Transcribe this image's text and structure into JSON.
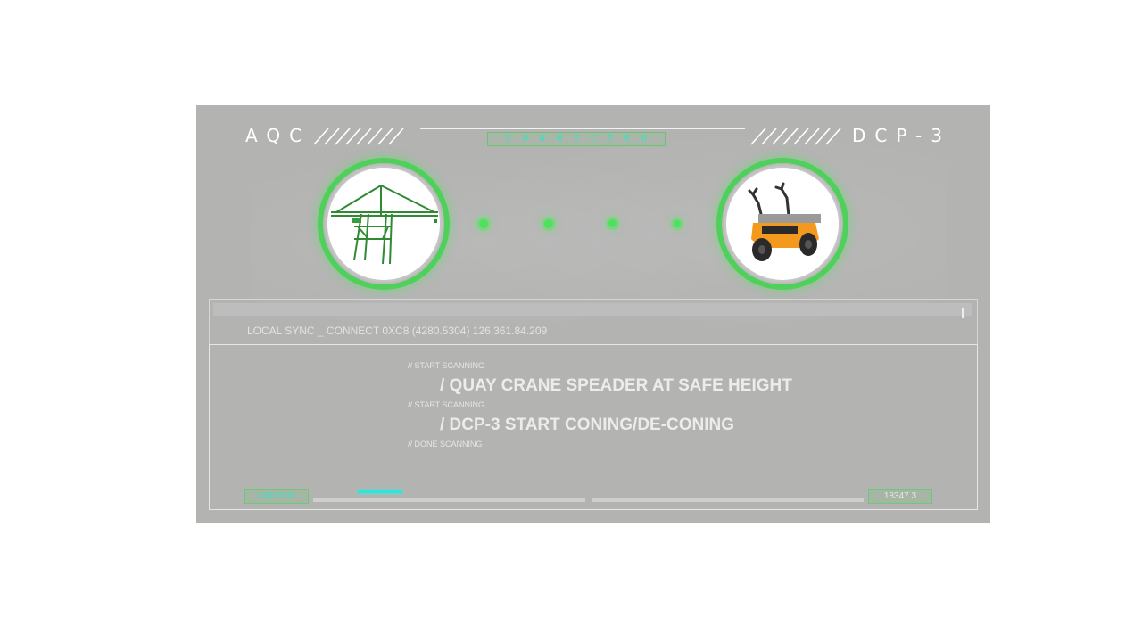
{
  "header": {
    "left_label": "AQC",
    "right_label": "DCP-3",
    "status": "CONNECTED"
  },
  "nodes": {
    "left": {
      "icon": "crane-icon"
    },
    "right": {
      "icon": "robot-vehicle-icon"
    }
  },
  "connection_dots": 4,
  "console": {
    "line": "LOCAL SYNC _ CONNECT 0XC8 (4280.5304) 126.361.84.209"
  },
  "log": [
    {
      "kind": "small",
      "text": "// START SCANNING"
    },
    {
      "kind": "big",
      "text": "/ QUAY CRANE SPEADER AT SAFE HEIGHT"
    },
    {
      "kind": "small",
      "text": "// START SCANNING"
    },
    {
      "kind": "big",
      "text": "/ DCP-3 START CONING/DE-CONING"
    },
    {
      "kind": "small",
      "text": "// DONE SCANNING"
    }
  ],
  "stats": {
    "left_value": "24406.06",
    "right_value": "18347.3"
  },
  "colors": {
    "accent_green": "#4fd05a",
    "accent_cyan": "#2ee6d8",
    "panel": "#b3b3b2"
  }
}
